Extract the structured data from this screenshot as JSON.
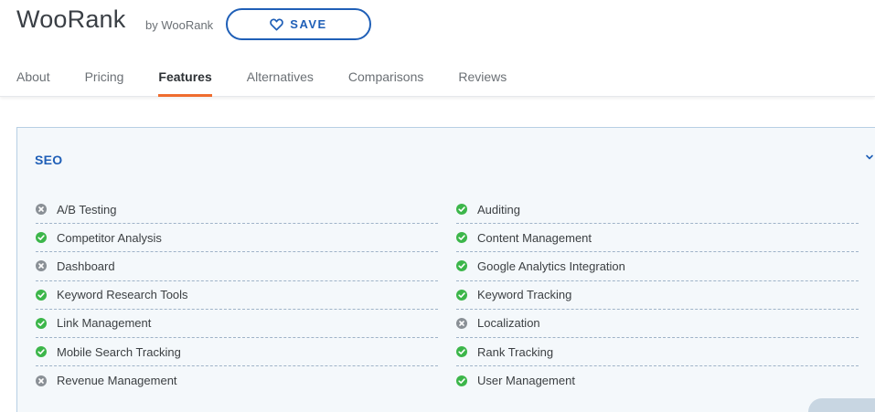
{
  "header": {
    "product_name": "WooRank",
    "vendor": "by WooRank",
    "save_label": "SAVE",
    "save_icon": "heart-outline-icon"
  },
  "tabs": [
    {
      "label": "About"
    },
    {
      "label": "Pricing"
    },
    {
      "label": "Features",
      "active": true
    },
    {
      "label": "Alternatives"
    },
    {
      "label": "Comparisons"
    },
    {
      "label": "Reviews"
    }
  ],
  "features_section": {
    "title": "SEO",
    "expand_icon": "chevron-down-icon",
    "left_column": [
      {
        "label": "A/B Testing",
        "available": false
      },
      {
        "label": "Competitor Analysis",
        "available": true
      },
      {
        "label": "Dashboard",
        "available": false
      },
      {
        "label": "Keyword Research Tools",
        "available": true
      },
      {
        "label": "Link Management",
        "available": true
      },
      {
        "label": "Mobile Search Tracking",
        "available": true
      },
      {
        "label": "Revenue Management",
        "available": false
      }
    ],
    "right_column": [
      {
        "label": "Auditing",
        "available": true
      },
      {
        "label": "Content Management",
        "available": true
      },
      {
        "label": "Google Analytics Integration",
        "available": true
      },
      {
        "label": "Keyword Tracking",
        "available": true
      },
      {
        "label": "Localization",
        "available": false
      },
      {
        "label": "Rank Tracking",
        "available": true
      },
      {
        "label": "User Management",
        "available": true
      }
    ]
  },
  "colors": {
    "accent_blue": "#1f5fb7",
    "active_tab_underline": "#ef6c2e",
    "available_green": "#3cb64a",
    "unavailable_gray": "#8a9096"
  }
}
